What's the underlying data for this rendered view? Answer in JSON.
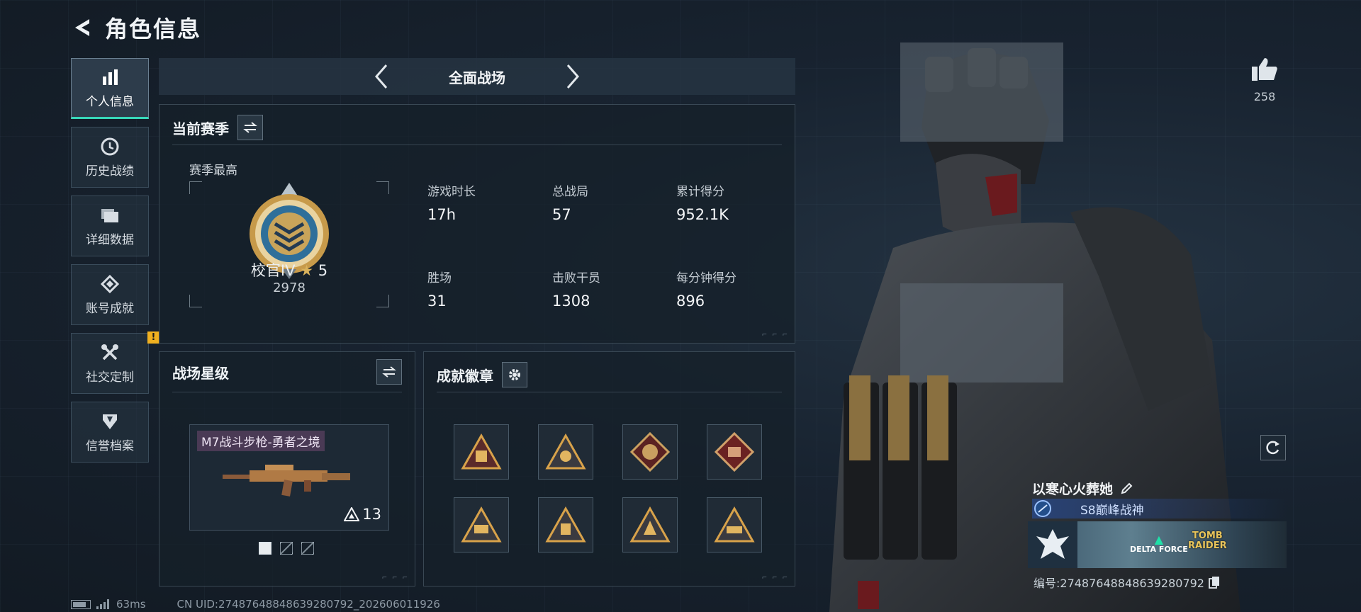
{
  "header": {
    "title": "角色信息"
  },
  "sidebar": {
    "items": [
      {
        "label": "个人信息",
        "icon": "bar-chart-icon",
        "active": true
      },
      {
        "label": "历史战绩",
        "icon": "history-icon"
      },
      {
        "label": "详细数据",
        "icon": "folder-icon"
      },
      {
        "label": "账号成就",
        "icon": "achievement-icon"
      },
      {
        "label": "社交定制",
        "icon": "tools-icon",
        "alert": "!"
      },
      {
        "label": "信誉档案",
        "icon": "shield-icon"
      }
    ]
  },
  "mode": {
    "title": "全面战场"
  },
  "season": {
    "title": "当前赛季",
    "best_label": "赛季最高",
    "rank_name": "校官IV",
    "rank_stars": "5",
    "rank_score": "2978",
    "stats": [
      {
        "label": "游戏时长",
        "value": "17h"
      },
      {
        "label": "总战局",
        "value": "57"
      },
      {
        "label": "累计得分",
        "value": "952.1K"
      },
      {
        "label": "胜场",
        "value": "31"
      },
      {
        "label": "击败干员",
        "value": "1308"
      },
      {
        "label": "每分钟得分",
        "value": "896"
      }
    ]
  },
  "star_level": {
    "title": "战场星级",
    "weapon_name": "M7战斗步枪-勇者之境",
    "weapon_level": "13",
    "page_index": 1,
    "page_count": 3
  },
  "badges": {
    "title": "成就徽章",
    "items": [
      "triangle-badge",
      "triangle-badge",
      "diamond-dragon-badge",
      "diamond-badge",
      "triangle-badge",
      "triangle-badge",
      "triangle-badge",
      "triangle-badge"
    ]
  },
  "profile": {
    "likes": "258",
    "player_name": "以寒心火葬她",
    "title": "S8巅峰战神",
    "banner_logo1": "DELTA FORCE",
    "banner_logo2_line1": "TOMB",
    "banner_logo2_line2": "RAIDER",
    "id_text": "编号:2748764884863928079​2"
  },
  "footer": {
    "ping": "63ms",
    "uid": "CN UID:2748764884863928079​2_202606011926"
  },
  "colors": {
    "accent": "#37d7b9",
    "alert": "#f0b020",
    "gold": "#d9b25c",
    "panel_bg": "#16202b"
  }
}
